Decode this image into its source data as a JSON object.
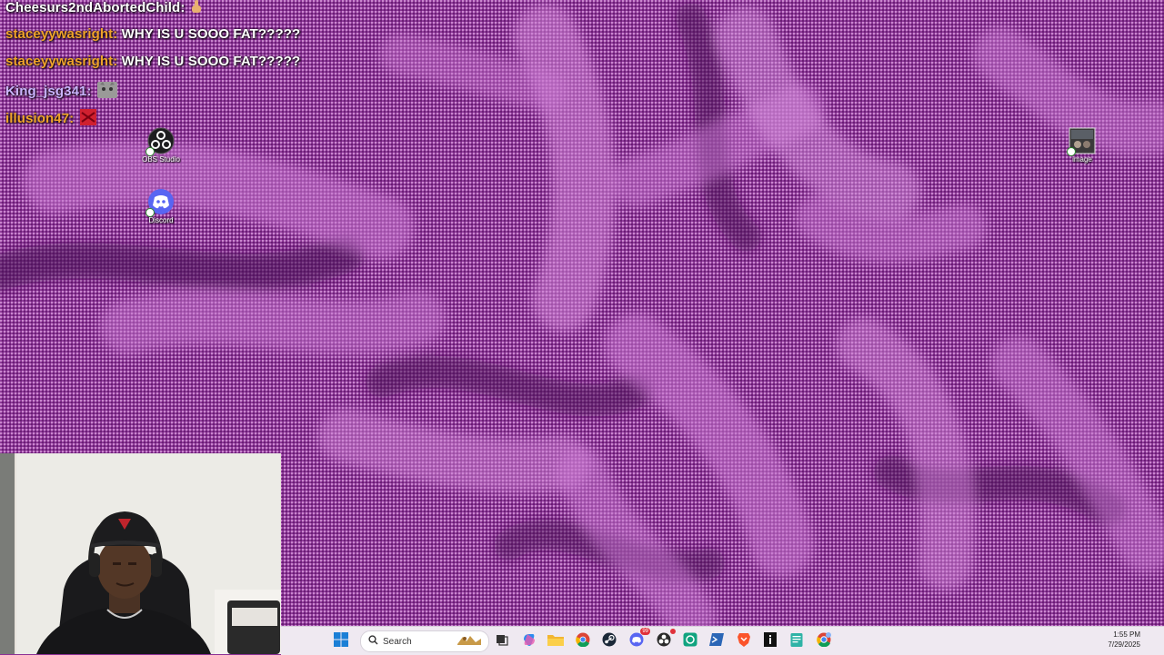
{
  "chat": {
    "messages": [
      {
        "user": "Cheesurs2ndAbortedChild:",
        "text": "",
        "user_color": "#ffffff",
        "emote": "finger-emote"
      },
      {
        "user": "staceyywasright:",
        "text": "WHY IS U SOOO FAT?????",
        "user_color": "#f0a32b"
      },
      {
        "user": "staceyywasright:",
        "text": "WHY IS U SOOO FAT?????",
        "user_color": "#f0a32b"
      },
      {
        "user": "King_jsg341:",
        "text": "",
        "user_color": "#cbb4ff",
        "emote": "cat-emote"
      },
      {
        "user": "illusion47:",
        "text": "",
        "user_color": "#f0a32b",
        "emote": "red-emote"
      }
    ]
  },
  "desktop_icons": [
    {
      "label": "OBS Studio",
      "icon": "obs-icon"
    },
    {
      "label": "Discord",
      "icon": "discord-icon",
      "color": "#5865f2"
    },
    {
      "label": "image",
      "icon": "image-thumbnail-icon"
    }
  ],
  "taskbar": {
    "search_placeholder": "Search",
    "apps": [
      "windows-start-icon",
      "search-icon",
      "widget-gallery-icon",
      "task-view-icon",
      "copilot-icon",
      "file-explorer-icon",
      "chrome-icon",
      "steam-icon",
      "discord-icon",
      "obs-icon",
      "chatgpt-icon",
      "powershell-icon",
      "brave-icon",
      "info-app-icon",
      "notepad-icon",
      "chrome-profile-icon"
    ],
    "discord_badge": "99",
    "time": "1:55 PM",
    "date": "7/29/2025"
  },
  "colors": {
    "wallpaper": "#8c3497",
    "taskbar": "#efe9f1",
    "chat_user_orange": "#f0a32b",
    "chat_user_lavender": "#cbb4ff"
  }
}
